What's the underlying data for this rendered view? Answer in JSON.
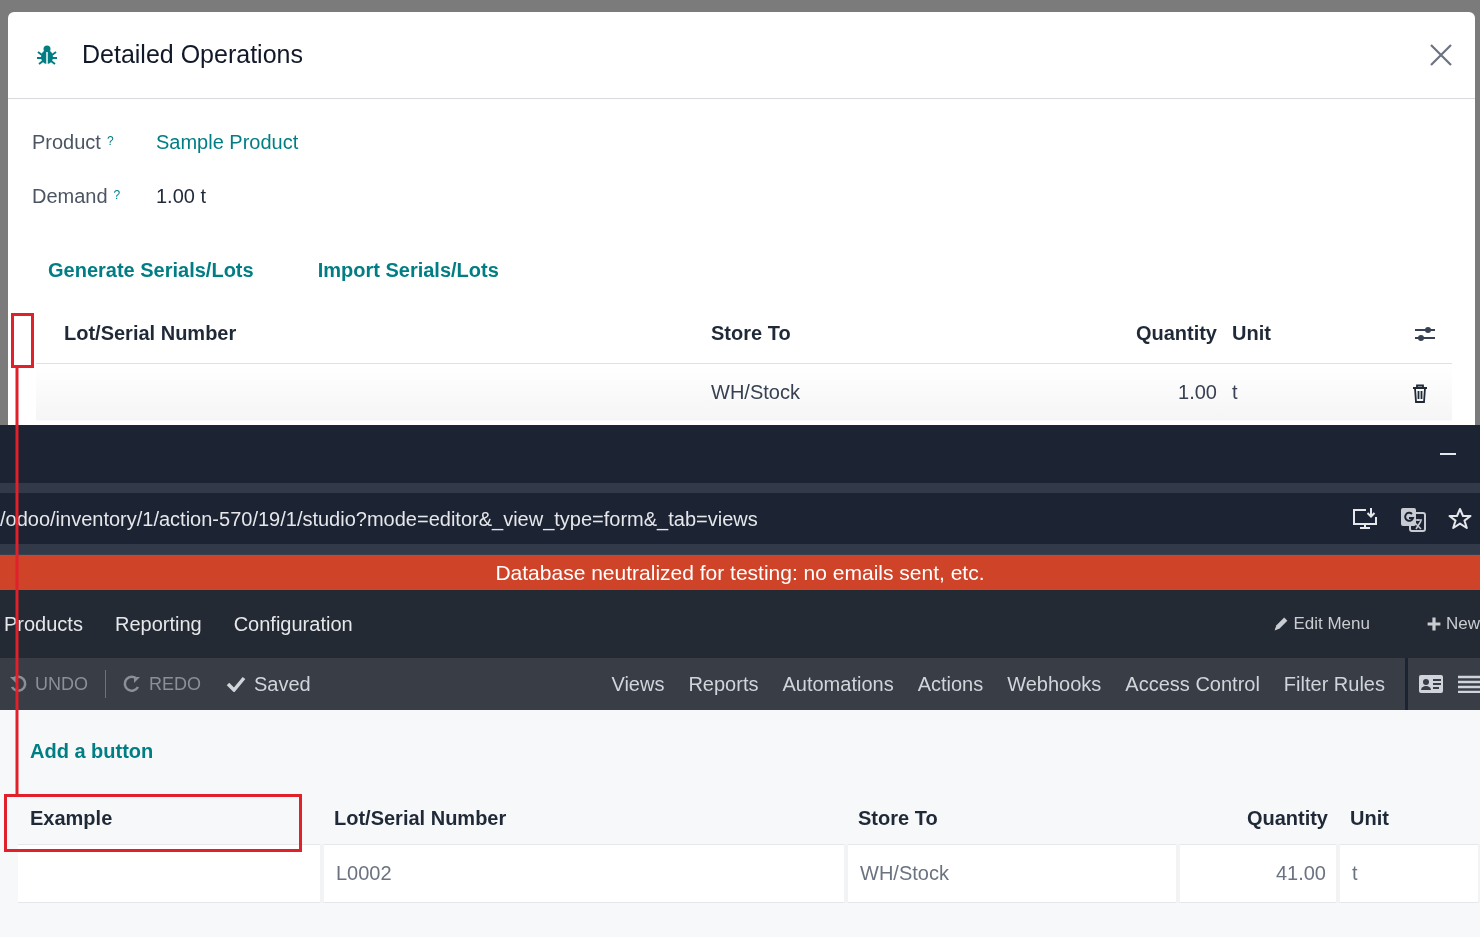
{
  "dialog": {
    "title": "Detailed Operations",
    "fields": [
      {
        "label": "Product",
        "help": "?",
        "value": "Sample Product",
        "kind": "link"
      },
      {
        "label": "Demand",
        "help": "?",
        "value": "1.00 t",
        "kind": "text"
      }
    ],
    "actions": [
      "Generate Serials/Lots",
      "Import Serials/Lots"
    ],
    "table": {
      "columns": [
        "Lot/Serial Number",
        "Store To",
        "Quantity",
        "Unit"
      ],
      "rows": [
        {
          "store_to": "WH/Stock",
          "quantity": "1.00",
          "unit": "t"
        }
      ]
    }
  },
  "browser": {
    "address": "/odoo/inventory/1/action-570/19/1/studio?mode=editor&_view_type=form&_tab=views",
    "banner": "Database neutralized for testing: no emails sent, etc.",
    "menu": [
      "Products",
      "Reporting",
      "Configuration"
    ],
    "menu_actions": [
      {
        "label": "Edit Menu",
        "kind": "edit"
      },
      {
        "label": "New",
        "kind": "new"
      }
    ],
    "studio_toolbar": {
      "undo": {
        "label": "UNDO",
        "disabled": true
      },
      "redo": {
        "label": "REDO",
        "disabled": true
      },
      "saved": "Saved",
      "tabs": [
        {
          "label": "Views",
          "selected": false
        },
        {
          "label": "Reports",
          "selected": false
        },
        {
          "label": "Automations",
          "selected": false
        },
        {
          "label": "Actions",
          "selected": false
        },
        {
          "label": "Webhooks",
          "selected": false
        },
        {
          "label": "Access Control",
          "selected": false
        },
        {
          "label": "Filter Rules",
          "selected": false
        }
      ]
    }
  },
  "preview": {
    "add_button": "Add a button",
    "columns": [
      "Example",
      "Lot/Serial Number",
      "Store To",
      "Quantity",
      "Unit"
    ],
    "rows": [
      {
        "lot": "L0002",
        "store_to": "WH/Stock",
        "quantity": "41.00",
        "unit": "t"
      }
    ]
  }
}
